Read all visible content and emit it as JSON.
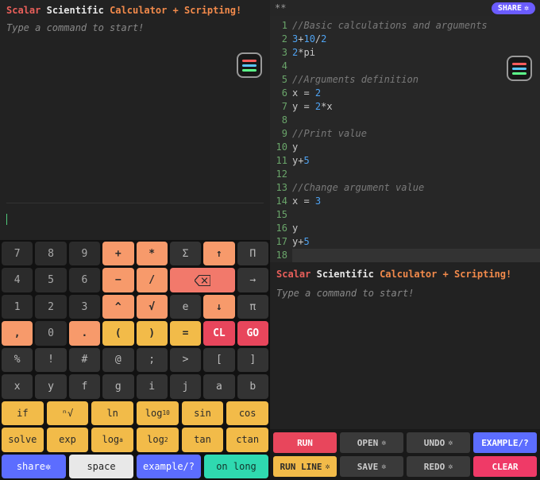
{
  "title": {
    "scalar": "Scalar",
    "scientific": "Scientific",
    "calcplus": "Calculator + Scripting!"
  },
  "prompt": "Type a command to start!",
  "dirty_marker": "**",
  "share_label": "SHARE",
  "keys": {
    "r1": [
      "7",
      "8",
      "9",
      "+",
      "*",
      "Σ",
      "↑",
      "Π"
    ],
    "r2": [
      "4",
      "5",
      "6",
      "−",
      "/",
      "",
      "",
      "→"
    ],
    "r3": [
      "1",
      "2",
      "3",
      "^",
      "√",
      "e",
      "↓",
      "π"
    ],
    "r4": [
      ",",
      "0",
      ".",
      "(",
      ")",
      "=",
      "CL",
      "GO"
    ],
    "r5": [
      "%",
      "!",
      "#",
      "@",
      ";",
      ">",
      "[",
      "]"
    ],
    "r6": [
      "x",
      "y",
      "f",
      "g",
      "i",
      "j",
      "a",
      "b"
    ],
    "fn1": [
      "if",
      "ⁿ√",
      "ln",
      "log₁₀",
      "sin",
      "cos"
    ],
    "fn2": [
      "solve",
      "exp",
      "logₐ",
      "log₂",
      "tan",
      "ctan"
    ],
    "bot": [
      "share",
      "space",
      "example/?",
      "on long"
    ]
  },
  "bksp_label": "⌫",
  "code": [
    {
      "n": 1,
      "cls": "cm",
      "text": "//Basic calculations and arguments"
    },
    {
      "n": 2,
      "cls": "",
      "text": "3+10/2",
      "tokens": [
        [
          "nm",
          "3"
        ],
        [
          "op",
          "+"
        ],
        [
          "nm",
          "10"
        ],
        [
          "op",
          "/"
        ],
        [
          "nm",
          "2"
        ]
      ]
    },
    {
      "n": 3,
      "cls": "",
      "text": "2*pi",
      "tokens": [
        [
          "nm",
          "2"
        ],
        [
          "op",
          "*"
        ],
        [
          "id",
          "pi"
        ]
      ]
    },
    {
      "n": 4,
      "cls": "",
      "text": ""
    },
    {
      "n": 5,
      "cls": "cm",
      "text": "//Arguments definition"
    },
    {
      "n": 6,
      "cls": "",
      "text": "x = 2",
      "tokens": [
        [
          "id",
          "x "
        ],
        [
          "op",
          "= "
        ],
        [
          "nm",
          "2"
        ]
      ]
    },
    {
      "n": 7,
      "cls": "",
      "text": "y = 2*x",
      "tokens": [
        [
          "id",
          "y "
        ],
        [
          "op",
          "= "
        ],
        [
          "nm",
          "2"
        ],
        [
          "op",
          "*"
        ],
        [
          "id",
          "x"
        ]
      ]
    },
    {
      "n": 8,
      "cls": "",
      "text": ""
    },
    {
      "n": 9,
      "cls": "cm",
      "text": "//Print value"
    },
    {
      "n": 10,
      "cls": "",
      "text": "y",
      "tokens": [
        [
          "id",
          "y"
        ]
      ]
    },
    {
      "n": 11,
      "cls": "",
      "text": "y+5",
      "tokens": [
        [
          "id",
          "y"
        ],
        [
          "op",
          "+"
        ],
        [
          "nm",
          "5"
        ]
      ]
    },
    {
      "n": 12,
      "cls": "",
      "text": ""
    },
    {
      "n": 13,
      "cls": "cm",
      "text": "//Change argument value"
    },
    {
      "n": 14,
      "cls": "",
      "text": "x = 3",
      "tokens": [
        [
          "id",
          "x "
        ],
        [
          "op",
          "= "
        ],
        [
          "nm",
          "3"
        ]
      ]
    },
    {
      "n": 15,
      "cls": "",
      "text": ""
    },
    {
      "n": 16,
      "cls": "",
      "text": "y",
      "tokens": [
        [
          "id",
          "y"
        ]
      ]
    },
    {
      "n": 17,
      "cls": "",
      "text": "y+5",
      "tokens": [
        [
          "id",
          "y"
        ],
        [
          "op",
          "+"
        ],
        [
          "nm",
          "5"
        ]
      ]
    },
    {
      "n": 18,
      "cls": "cursor",
      "text": ""
    }
  ],
  "actions": {
    "run": "RUN",
    "open": "OPEN",
    "undo": "UNDO",
    "example": "EXAMPLE/?",
    "runline": "RUN LINE",
    "save": "SAVE",
    "redo": "REDO",
    "clear": "CLEAR"
  }
}
